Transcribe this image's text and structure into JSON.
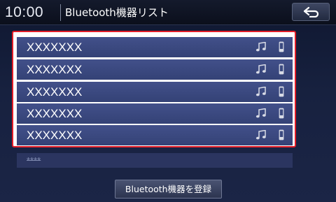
{
  "header": {
    "clock": "10:00",
    "title": "Bluetooth機器リスト",
    "back_icon": "back-arrow-icon"
  },
  "devices": [
    {
      "name": "XXXXXXX",
      "icons": [
        "music-note-icon",
        "phone-icon"
      ]
    },
    {
      "name": "XXXXXXX",
      "icons": [
        "music-note-icon",
        "phone-icon"
      ]
    },
    {
      "name": "XXXXXXX",
      "icons": [
        "music-note-icon",
        "phone-icon"
      ]
    },
    {
      "name": "XXXXXXX",
      "icons": [
        "music-note-icon",
        "phone-icon"
      ]
    },
    {
      "name": "XXXXXXX",
      "icons": [
        "music-note-icon",
        "phone-icon"
      ]
    }
  ],
  "empty_slot": {
    "label": "****"
  },
  "footer": {
    "register_label": "Bluetooth機器を登録"
  },
  "colors": {
    "highlight_border": "#e21c27",
    "row_background": "#3b4a80",
    "background": "#17213f"
  }
}
